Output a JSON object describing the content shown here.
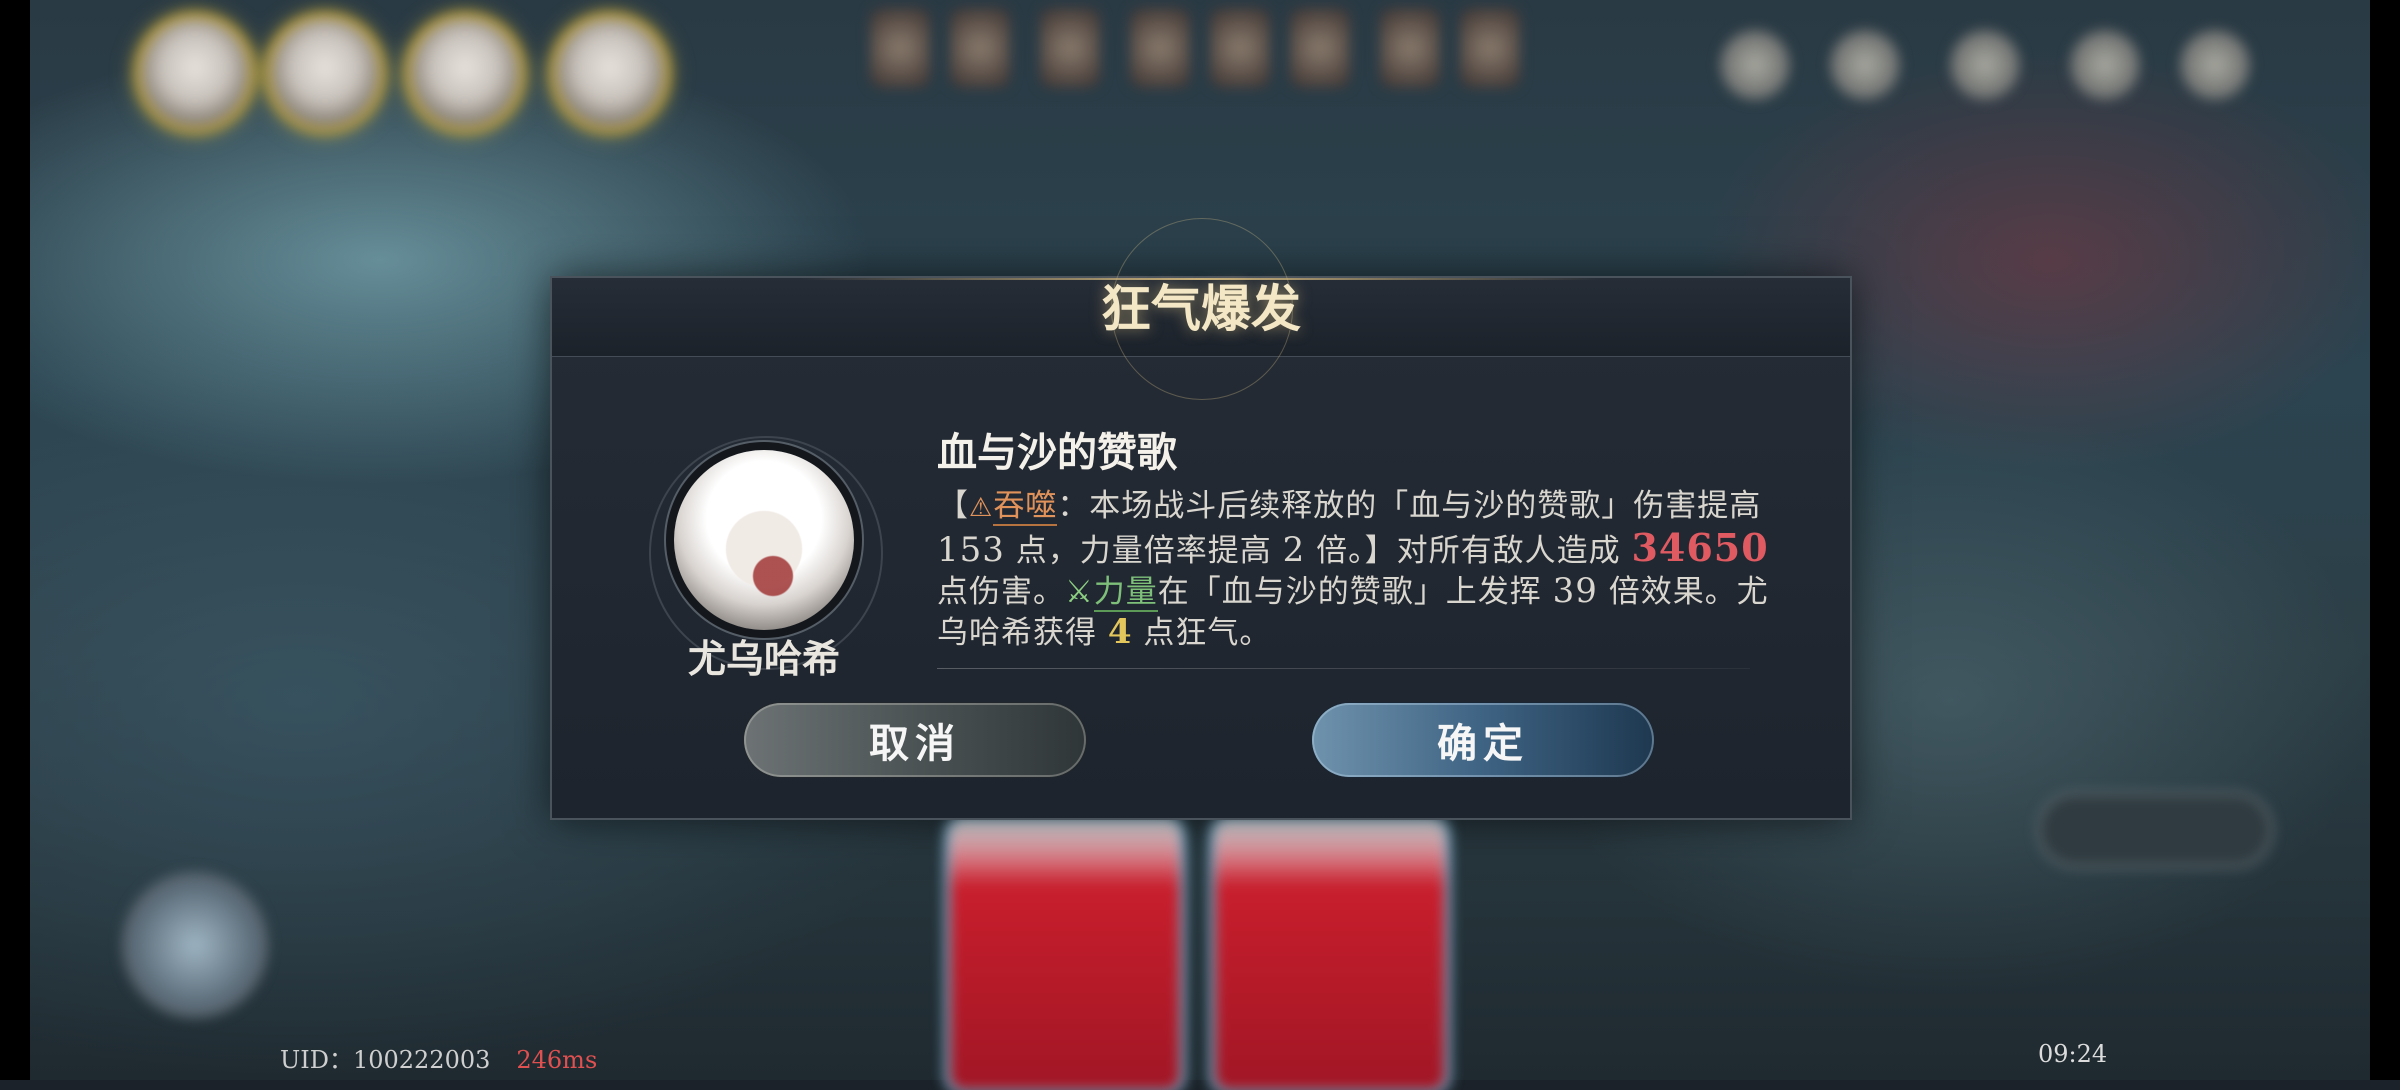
{
  "dialog": {
    "title": "狂气爆发",
    "character_name": "尤乌哈希",
    "skill_name": "血与沙的赞歌",
    "desc": {
      "p1": "【",
      "devour_keyword": "吞噬",
      "p2": "：本场战斗后续释放的「血与沙的赞歌」伤害提高",
      "dmg_increase": "153",
      "p3": "点，力量倍率提高",
      "multiplier_increase": "2",
      "p4": "倍。】对所有敌人造成",
      "damage": "34650",
      "p5": "点伤害。",
      "strength_keyword": "力量",
      "p6": "在「血与沙的赞歌」上发挥",
      "strength_effect": "39",
      "p7": "倍效果。尤乌哈希获得",
      "madness_gain": "4",
      "p8": "点狂气。"
    },
    "cancel_label": "取消",
    "confirm_label": "确定"
  },
  "footer": {
    "uid": "UID：100222003",
    "ping": "246ms",
    "clock": "09:24"
  },
  "icons": {
    "warning": "⚠",
    "sword": "⚔"
  },
  "colors": {
    "accent_gold": "#e3c65c",
    "damage_red": "#e05a62",
    "devour_orange": "#e0925a",
    "strength_green": "#7ec07a",
    "confirm_blue": "#3e6383"
  }
}
